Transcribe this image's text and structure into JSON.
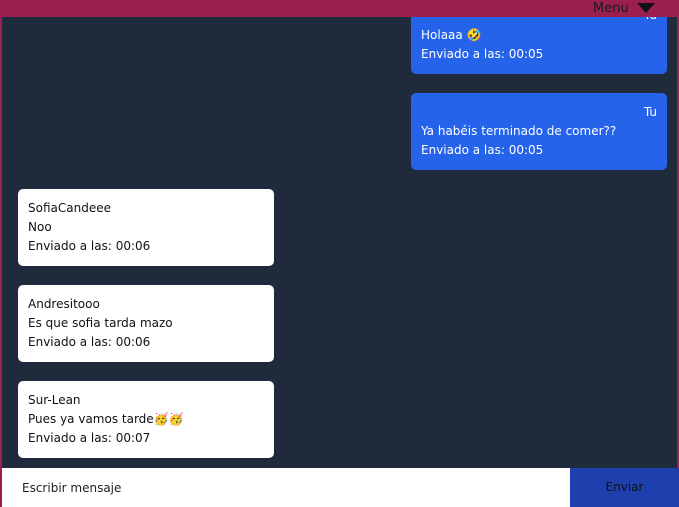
{
  "header": {
    "menu_label": "Menu",
    "menu_icon": "caret-down-icon"
  },
  "messages": [
    {
      "author": "Tu",
      "text": "Holaaa 🤣",
      "time": "Enviado a las: 00:05",
      "own": true
    },
    {
      "author": "Tu",
      "text": "Ya habéis terminado de comer??",
      "time": "Enviado a las: 00:05",
      "own": true
    },
    {
      "author": "SofiaCandeee",
      "text": "Noo",
      "time": "Enviado a las: 00:06",
      "own": false
    },
    {
      "author": "Andresitooo",
      "text": "Es que sofia tarda mazo",
      "time": "Enviado a las: 00:06",
      "own": false
    },
    {
      "author": "Sur-Lean",
      "text": "Pues ya vamos tarde🥳🥳",
      "time": "Enviado a las: 00:07",
      "own": false
    }
  ],
  "composer": {
    "placeholder": "Escribir mensaje",
    "send_label": "Enviar"
  },
  "colors": {
    "background": "#1f2a3c",
    "header": "#9b2050",
    "own_bubble": "#2563eb",
    "other_bubble": "#ffffff",
    "send_button": "#1e40af"
  }
}
